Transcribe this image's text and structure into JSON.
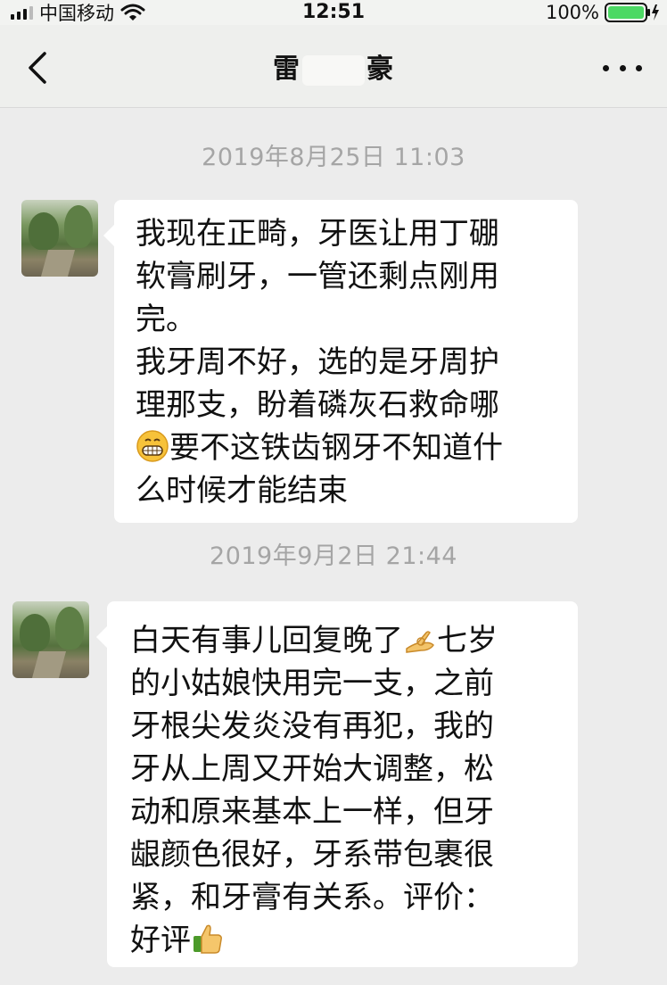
{
  "status_bar": {
    "carrier": "中国移动",
    "time": "12:51",
    "battery": "100%"
  },
  "nav": {
    "title_visible_left": "雷",
    "title_visible_right": "豪"
  },
  "messages": [
    {
      "timestamp": "2019年8月25日 11:03",
      "lines": [
        "我现在正畸，牙医让用丁硼",
        "软膏刷牙，一管还剩点刚用",
        "完。",
        "我牙周不好，选的是牙周护",
        "理那支，盼着磷灰石救命哪"
      ],
      "line6_text": "要不这铁齿钢牙不知道什",
      "line6_emoji": "grinning-face-emoji",
      "line7": "么时候才能结束"
    },
    {
      "timestamp": "2019年9月2日 21:44",
      "line1_text": "白天有事儿回复晚了",
      "line1_emoji": "ok-hand-emoji",
      "line1_tail": "七岁",
      "lines": [
        "的小姑娘快用完一支，之前",
        "牙根尖发炎没有再犯，我的",
        "牙从上周又开始大调整，松",
        "动和原来基本上一样，但牙",
        "龈颜色很好，牙系带包裹很",
        "紧，和牙膏有关系。评价："
      ],
      "last_text": "好评",
      "last_emoji": "thumbs-up-emoji"
    }
  ],
  "colors": {
    "background": "#ececec",
    "bubble": "#ffffff",
    "timestamp": "#a5a5a5",
    "battery_green": "#4cd964"
  }
}
